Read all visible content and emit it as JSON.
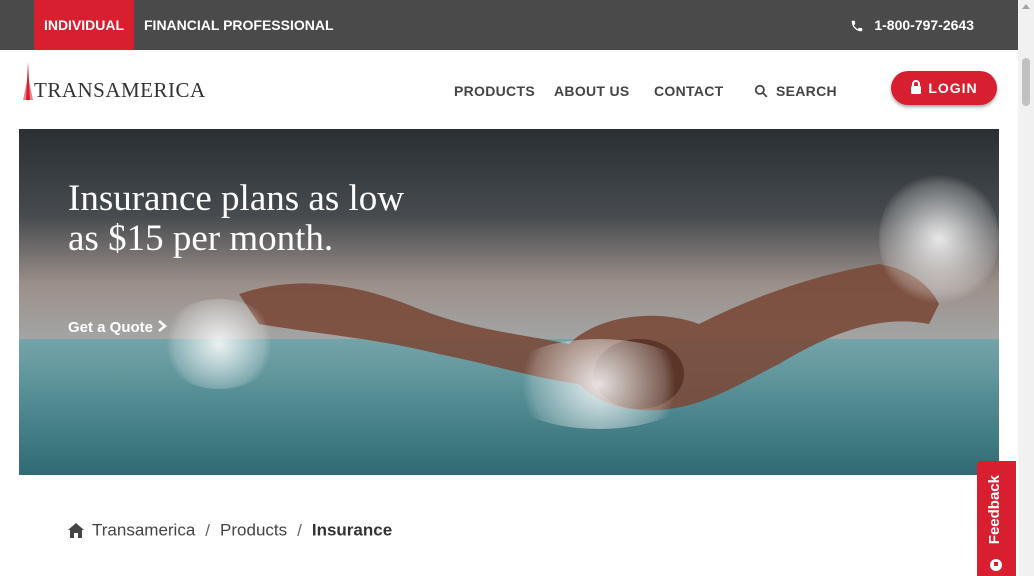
{
  "topbar": {
    "tabs": [
      {
        "label": "INDIVIDUAL",
        "active": true
      },
      {
        "label": "FINANCIAL PROFESSIONAL",
        "active": false
      }
    ],
    "phone": "1-800-797-2643"
  },
  "header": {
    "logo_text": "TRANSAMERICA",
    "nav": [
      "PRODUCTS",
      "ABOUT US",
      "CONTACT",
      "SEARCH"
    ],
    "login_label": "LOGIN"
  },
  "hero": {
    "title": "Insurance plans as low as $15 per month.",
    "cta": "Get a Quote"
  },
  "breadcrumb": [
    "Transamerica",
    "Products",
    "Insurance"
  ],
  "feedback": {
    "label": "Feedback"
  },
  "colors": {
    "brand_red": "#d71f2f",
    "topbar": "#4a4a4a"
  }
}
